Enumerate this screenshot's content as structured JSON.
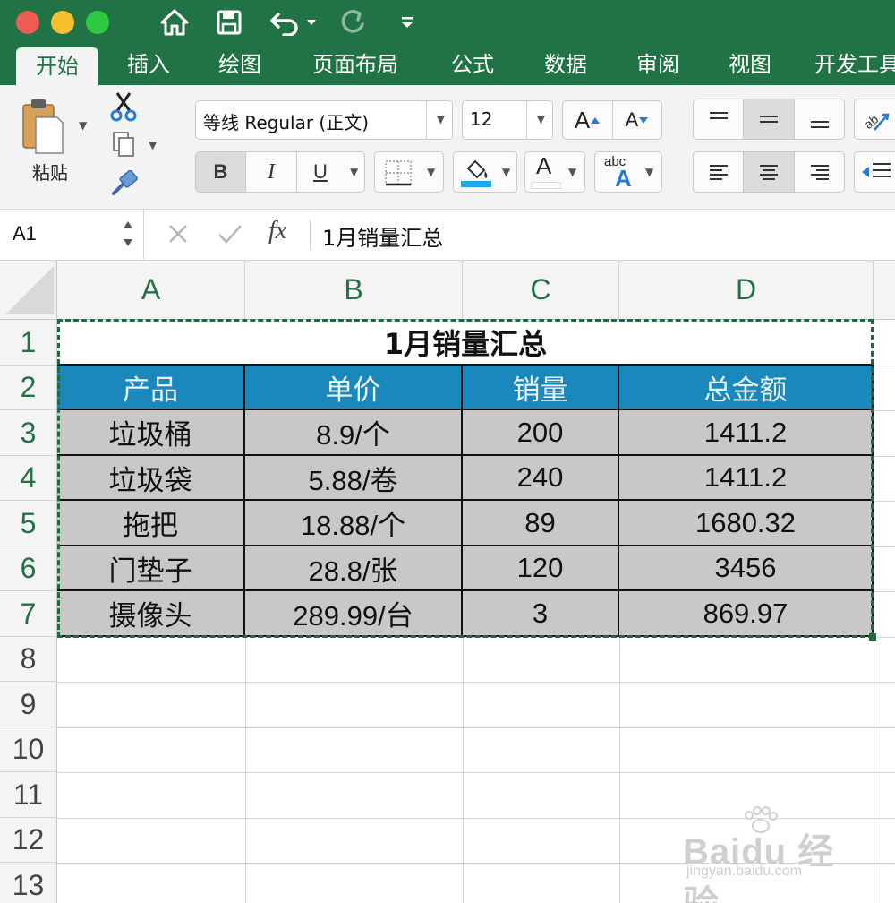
{
  "titlebar": {
    "traffic_lights": [
      "#ee5c55",
      "#f7bf2e",
      "#2ec940"
    ]
  },
  "tabs": [
    {
      "label": "开始",
      "active": true
    },
    {
      "label": "插入"
    },
    {
      "label": "绘图"
    },
    {
      "label": "页面布局"
    },
    {
      "label": "公式"
    },
    {
      "label": "数据"
    },
    {
      "label": "审阅"
    },
    {
      "label": "视图"
    },
    {
      "label": "开发工具"
    }
  ],
  "ribbon": {
    "paste_label": "粘贴",
    "font_name": "等线 Regular (正文)",
    "font_size": "12",
    "bold": "B",
    "italic": "I",
    "underline": "U",
    "font_color_glyph": "A",
    "increase_font_glyph": "A",
    "decrease_font_glyph": "A",
    "abc_label": "abc",
    "abc_glyph": "A"
  },
  "formula_bar": {
    "name_box": "A1",
    "fx": "fx",
    "content": "1月销量汇总"
  },
  "sheet": {
    "columns": [
      "A",
      "B",
      "C",
      "D"
    ],
    "rows": [
      "1",
      "2",
      "3",
      "4",
      "5",
      "6",
      "7",
      "8",
      "9",
      "10",
      "11",
      "12",
      "13"
    ],
    "title": "1月销量汇总",
    "headers": [
      "产品",
      "单价",
      "销量",
      "总金额"
    ],
    "data": [
      [
        "垃圾桶",
        "8.9/个",
        "200",
        "1411.2"
      ],
      [
        "垃圾袋",
        "5.88/卷",
        "240",
        "1411.2"
      ],
      [
        "拖把",
        "18.88/个",
        "89",
        "1680.32"
      ],
      [
        "门垫子",
        "28.8/张",
        "120",
        "3456"
      ],
      [
        "摄像头",
        "289.99/台",
        "3",
        "869.97"
      ]
    ]
  },
  "watermark": {
    "logo": "Baidu 经验",
    "url": "jingyan.baidu.com"
  },
  "colors": {
    "excel_green": "#217346",
    "header_blue": "#1a87bd",
    "body_gray": "#c8c8c8"
  }
}
